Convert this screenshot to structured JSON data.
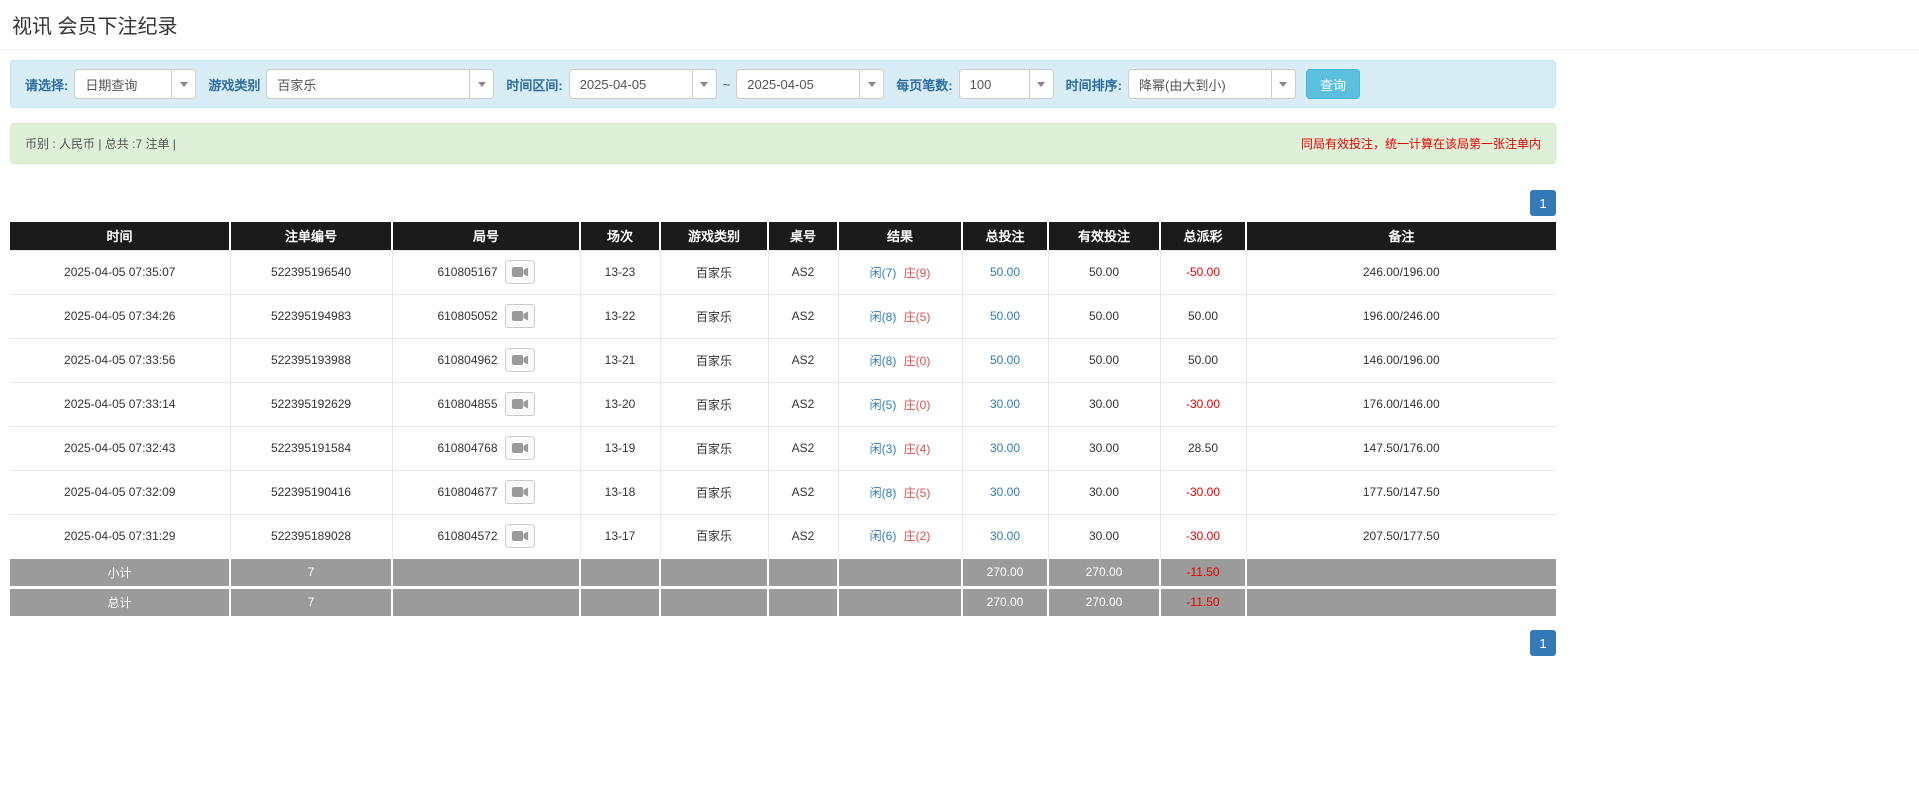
{
  "page": {
    "title": "视讯 会员下注纪录"
  },
  "filter_bar": {
    "select_label": "请选择:",
    "select_value": "日期查询",
    "game_type_label": "游戏类别",
    "game_type_value": "百家乐",
    "time_range_label": "时间区间:",
    "date_from": "2025-04-05",
    "tilde": "~",
    "date_to": "2025-04-05",
    "page_size_label": "每页笔数:",
    "page_size_value": "100",
    "sort_label": "时间排序:",
    "sort_value": "降幂(由大到小)",
    "search_button_label": "查询"
  },
  "summary_bar": {
    "currency_total_text": "币别 : 人民币 | 总共 :7 注单 |",
    "notice_text": "同局有效投注，统一计算在该局第一张注单内"
  },
  "pagination": {
    "current_page": "1"
  },
  "table": {
    "headers": {
      "time": "时间",
      "bet_id": "注单编号",
      "round_id": "局号",
      "session": "场次",
      "game_type": "游戏类别",
      "table_no": "桌号",
      "result": "结果",
      "total_bet": "总投注",
      "valid_bet": "有效投注",
      "payout": "总派彩",
      "remark": "备注"
    },
    "rows": [
      {
        "time": "2025-04-05 07:35:07",
        "bet_id": "522395196540",
        "round_id": "610805167",
        "session": "13-23",
        "game_type": "百家乐",
        "table_no": "AS2",
        "result_player": "闲(7)",
        "result_banker": "庄(9)",
        "total_bet": "50.00",
        "valid_bet": "50.00",
        "payout": "-50.00",
        "remark": "246.00/196.00"
      },
      {
        "time": "2025-04-05 07:34:26",
        "bet_id": "522395194983",
        "round_id": "610805052",
        "session": "13-22",
        "game_type": "百家乐",
        "table_no": "AS2",
        "result_player": "闲(8)",
        "result_banker": "庄(5)",
        "total_bet": "50.00",
        "valid_bet": "50.00",
        "payout": "50.00",
        "remark": "196.00/246.00"
      },
      {
        "time": "2025-04-05 07:33:56",
        "bet_id": "522395193988",
        "round_id": "610804962",
        "session": "13-21",
        "game_type": "百家乐",
        "table_no": "AS2",
        "result_player": "闲(8)",
        "result_banker": "庄(0)",
        "total_bet": "50.00",
        "valid_bet": "50.00",
        "payout": "50.00",
        "remark": "146.00/196.00"
      },
      {
        "time": "2025-04-05 07:33:14",
        "bet_id": "522395192629",
        "round_id": "610804855",
        "session": "13-20",
        "game_type": "百家乐",
        "table_no": "AS2",
        "result_player": "闲(5)",
        "result_banker": "庄(0)",
        "total_bet": "30.00",
        "valid_bet": "30.00",
        "payout": "-30.00",
        "remark": "176.00/146.00"
      },
      {
        "time": "2025-04-05 07:32:43",
        "bet_id": "522395191584",
        "round_id": "610804768",
        "session": "13-19",
        "game_type": "百家乐",
        "table_no": "AS2",
        "result_player": "闲(3)",
        "result_banker": "庄(4)",
        "total_bet": "30.00",
        "valid_bet": "30.00",
        "payout": "28.50",
        "remark": "147.50/176.00"
      },
      {
        "time": "2025-04-05 07:32:09",
        "bet_id": "522395190416",
        "round_id": "610804677",
        "session": "13-18",
        "game_type": "百家乐",
        "table_no": "AS2",
        "result_player": "闲(8)",
        "result_banker": "庄(5)",
        "total_bet": "30.00",
        "valid_bet": "30.00",
        "payout": "-30.00",
        "remark": "177.50/147.50"
      },
      {
        "time": "2025-04-05 07:31:29",
        "bet_id": "522395189028",
        "round_id": "610804572",
        "session": "13-17",
        "game_type": "百家乐",
        "table_no": "AS2",
        "result_player": "闲(6)",
        "result_banker": "庄(2)",
        "total_bet": "30.00",
        "valid_bet": "30.00",
        "payout": "-30.00",
        "remark": "207.50/177.50"
      }
    ],
    "subtotal_row": {
      "label": "小计",
      "count": "7",
      "total_bet": "270.00",
      "valid_bet": "270.00",
      "payout": "-11.50"
    },
    "total_row": {
      "label": "总计",
      "count": "7",
      "total_bet": "270.00",
      "valid_bet": "270.00",
      "payout": "-11.50"
    }
  },
  "colors": {
    "accent_blue": "#337ab7",
    "search_button_blue": "#5bc0de",
    "negative_red": "#e60000",
    "player_blue": "#337ab7",
    "banker_red": "#d9534f",
    "header_black": "#1b1b1b",
    "summary_gray": "#9b9b9b",
    "filter_bg": "#d9edf7",
    "alert_bg": "#dff0d8"
  }
}
